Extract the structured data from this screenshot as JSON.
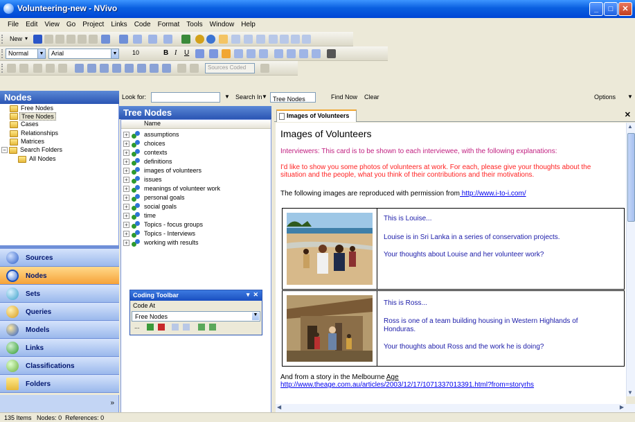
{
  "window": {
    "title": "Volunteering-new - NVivo"
  },
  "menu": [
    "File",
    "Edit",
    "View",
    "Go",
    "Project",
    "Links",
    "Code",
    "Format",
    "Tools",
    "Window",
    "Help"
  ],
  "toolbar": {
    "new_label": "New",
    "style_value": "Normal",
    "font_value": "Arial",
    "size_value": "10",
    "sources_coded": "Sources Coded"
  },
  "nav": {
    "header": "Nodes",
    "tree": [
      {
        "label": "Free Nodes",
        "indent": 1
      },
      {
        "label": "Tree Nodes",
        "indent": 1,
        "selected": true
      },
      {
        "label": "Cases",
        "indent": 1
      },
      {
        "label": "Relationships",
        "indent": 1
      },
      {
        "label": "Matrices",
        "indent": 1
      },
      {
        "label": "Search Folders",
        "indent": 0
      },
      {
        "label": "All Nodes",
        "indent": 2
      }
    ],
    "buttons": [
      {
        "label": "Sources",
        "icon": "sources-icon"
      },
      {
        "label": "Nodes",
        "icon": "nodes-icon",
        "active": true
      },
      {
        "label": "Sets",
        "icon": "sets-icon"
      },
      {
        "label": "Queries",
        "icon": "queries-icon"
      },
      {
        "label": "Models",
        "icon": "models-icon"
      },
      {
        "label": "Links",
        "icon": "links-icon"
      },
      {
        "label": "Classifications",
        "icon": "classifications-icon"
      },
      {
        "label": "Folders",
        "icon": "folders-icon"
      }
    ]
  },
  "find": {
    "look_for_label": "Look for:",
    "look_for_value": "",
    "search_in_label": "Search In",
    "search_in_value": "Tree Nodes",
    "find_now": "Find Now",
    "clear": "Clear",
    "options": "Options"
  },
  "tree_nodes": {
    "header": "Tree Nodes",
    "column_name": "Name",
    "items": [
      "assumptions",
      "choices",
      "contexts",
      "definitions",
      "images of volunteers",
      "issues",
      "meanings of volunteer work",
      "personal goals",
      "social goals",
      "time",
      "Topics - focus groups",
      "Topics - Interviews",
      "working with results"
    ]
  },
  "coding_toolbar": {
    "title": "Coding Toolbar",
    "code_at": "Code At",
    "value": "Free Nodes"
  },
  "detail": {
    "tab_label": "Images of Volunteers",
    "doc_title": "Images of Volunteers",
    "intro": "Interviewers: This card is to be shown to each interviewee, with the following explanations:",
    "request": "I'd like to show you some photos of volunteers at work. For each, please give your thoughts about the situation and the people, what you think of their contributions and their motivations.",
    "permission_text": "The following images are reproduced with permission from",
    "permission_link": " http://www.i-to-i.com/",
    "louise": {
      "line1": "This is Louise...",
      "line2": "Louise is in Sri Lanka in a series of conservation projects.",
      "line3": "Your thoughts about Louise and her volunteer work?"
    },
    "ross": {
      "line1": "This is Ross...",
      "line2a": "Ross is one of a team building housing in Western Highlands of",
      "line2b": "Honduras.",
      "line3": "Your thoughts about Ross and the work he is doing?"
    },
    "story_text": "And from a story in the Melbourne",
    "story_source": "Age",
    "story_link": "http://www.theage.com.au/articles/2003/12/17/1071337013391.html?from=storyrhs"
  },
  "status": {
    "items": "135 Items",
    "nodes": "Nodes: 0",
    "references": "References: 0"
  }
}
